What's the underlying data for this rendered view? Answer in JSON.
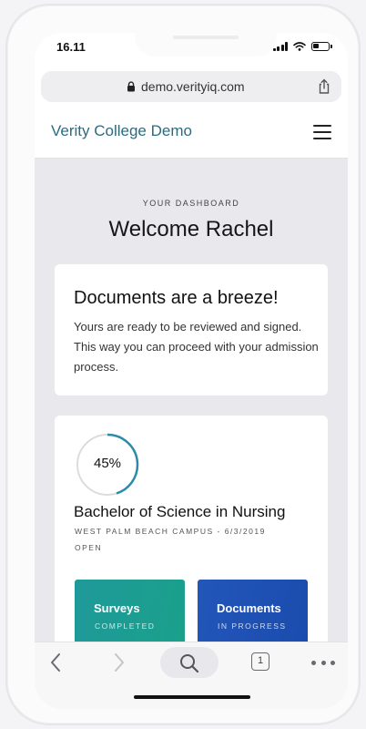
{
  "status": {
    "time": "16.11"
  },
  "browser": {
    "url": "demo.verityiq.com",
    "tab_count": "1"
  },
  "app": {
    "title": "Verity College Demo"
  },
  "dashboard": {
    "eyebrow": "YOUR DASHBOARD",
    "greeting": "Welcome Rachel"
  },
  "notice": {
    "title": "Documents are a breeze!",
    "body": "Yours are ready to be reviewed and signed. This way you can proceed with your admission process."
  },
  "enrollment": {
    "progress_percent": 45,
    "progress_label": "45%",
    "program": "Bachelor of Science in Nursing",
    "campus_date": "WEST PALM BEACH CAMPUS - 6/3/2019",
    "status": "OPEN"
  },
  "tiles": [
    {
      "title": "Surveys",
      "subtitle": "COMPLETED",
      "color": "#1e9a9a"
    },
    {
      "title": "Documents",
      "subtitle": "IN PROGRESS",
      "color": "#2256b8"
    }
  ],
  "colors": {
    "accent": "#2c6c80",
    "progress_ring": "#2a8ca8",
    "surveys": "#1e9a9a",
    "documents": "#2256b8"
  },
  "icons": [
    "lock-icon",
    "share-icon",
    "menu-icon",
    "back-icon",
    "forward-icon",
    "search-icon",
    "tabs-icon",
    "more-icon"
  ]
}
